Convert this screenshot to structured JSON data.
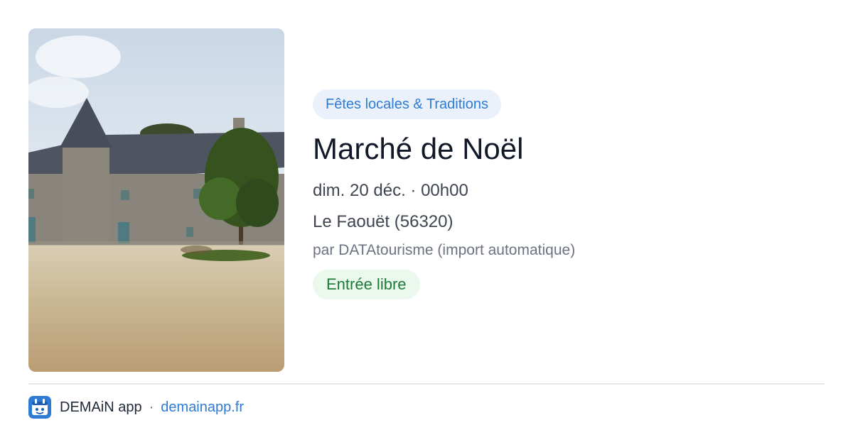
{
  "event": {
    "category": "Fêtes locales & Traditions",
    "title": "Marché de Noël",
    "datetime": "dim. 20 déc. · 00h00",
    "location": "Le Faouët (56320)",
    "source": "par DATAtourisme (import automatique)",
    "price": "Entrée libre"
  },
  "footer": {
    "app_name": "DEMAiN app",
    "separator": "·",
    "domain": "demainapp.fr"
  },
  "colors": {
    "accent": "#2f7bd4",
    "category_bg": "#eaf1fb",
    "price_text": "#1e7a37",
    "price_bg": "#eaf8ee"
  },
  "icons": {
    "app_logo": "demain-app-logo-icon"
  }
}
